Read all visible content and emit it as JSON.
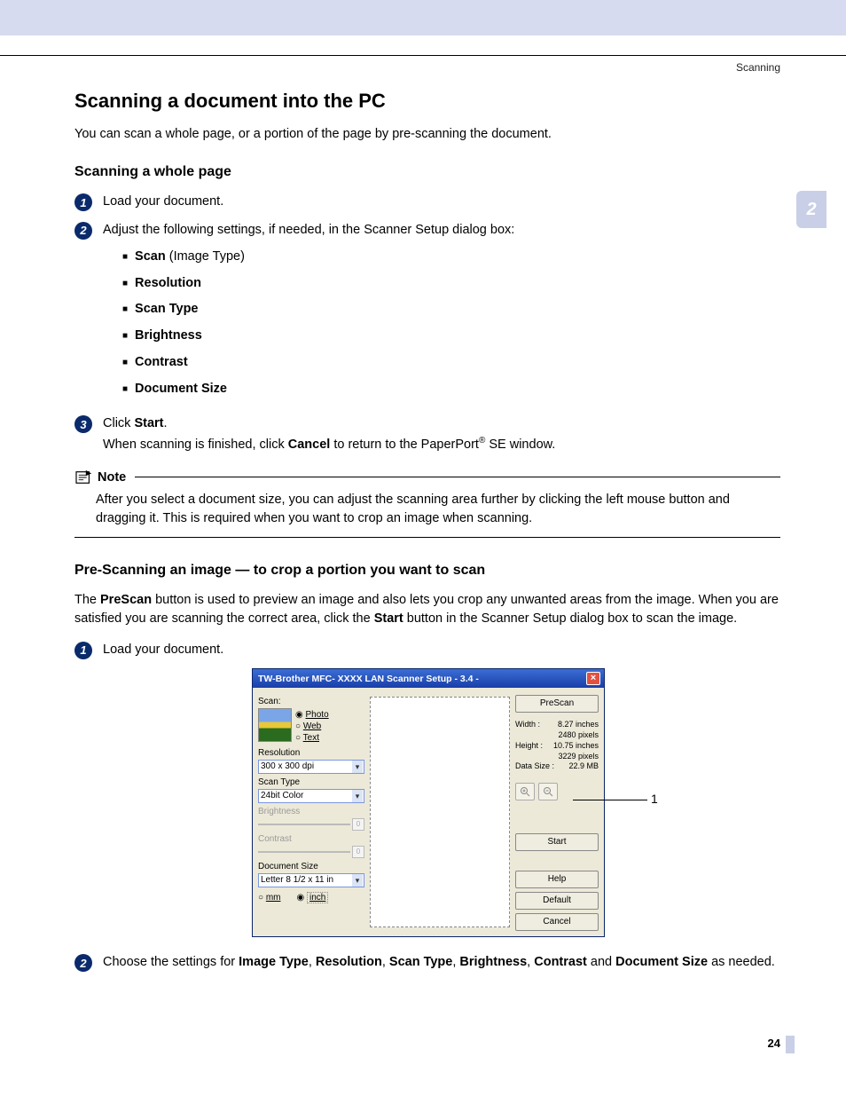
{
  "header": {
    "section": "Scanning",
    "chapter_tab": "2"
  },
  "h1": "Scanning a document into the PC",
  "intro": "You can scan a whole page, or a portion of the page by pre-scanning the document.",
  "secA": {
    "title": "Scanning a whole page",
    "step1": "Load your document.",
    "step2_lead": "Adjust the following settings, if needed, in the Scanner Setup dialog box:",
    "bullets_scan_prefix": "Scan",
    "bullets_scan_suffix": " (Image Type)",
    "b_resolution": "Resolution",
    "b_scantype": "Scan Type",
    "b_brightness": "Brightness",
    "b_contrast": "Contrast",
    "b_docsize": "Document Size",
    "step3_a": "Click ",
    "step3_b": "Start",
    "step3_c": ".",
    "step3_line2_a": "When scanning is finished, click ",
    "step3_line2_b": "Cancel",
    "step3_line2_c": " to return to the PaperPort",
    "step3_line2_d": " SE window."
  },
  "note": {
    "title": "Note",
    "body": "After you select a document size, you can adjust the scanning area further by clicking the left mouse button and dragging it. This is required when you want to crop an image when scanning."
  },
  "secB": {
    "title": "Pre-Scanning an image — to crop a portion you want to scan",
    "p_a": "The ",
    "p_b": "PreScan",
    "p_c": " button is used to preview an image and also lets you crop any unwanted areas from the image. When you are satisfied you are scanning the correct area, click the ",
    "p_d": "Start",
    "p_e": " button in the Scanner Setup dialog box to scan the image.",
    "step1": "Load your document.",
    "step2_a": "Choose the settings for ",
    "step2_b": "Image Type",
    "step2_c": ", ",
    "step2_d": "Resolution",
    "step2_e": ", ",
    "step2_f": "Scan Type",
    "step2_g": ", ",
    "step2_h": "Brightness",
    "step2_i": ", ",
    "step2_j": "Contrast",
    "step2_k": " and ",
    "step2_l": "Document Size",
    "step2_m": " as needed."
  },
  "dialog": {
    "title": "TW-Brother MFC- XXXX  LAN Scanner Setup - 3.4 -",
    "scan_label": "Scan:",
    "radio_photo": "Photo",
    "radio_web": "Web",
    "radio_text": "Text",
    "res_label": "Resolution",
    "res_value": "300 x 300 dpi",
    "scantype_label": "Scan Type",
    "scantype_value": "24bit Color",
    "brightness_label": "Brightness",
    "contrast_label": "Contrast",
    "docsize_label": "Document Size",
    "docsize_value": "Letter 8 1/2 x 11 in",
    "unit_mm": "mm",
    "unit_inch": "inch",
    "btn_prescan": "PreScan",
    "info_width_l": "Width :",
    "info_width_v": "8.27 inches",
    "info_width_px": "2480 pixels",
    "info_height_l": "Height :",
    "info_height_v": "10.75 inches",
    "info_height_px": "3229 pixels",
    "info_size_l": "Data Size :",
    "info_size_v": "22.9 MB",
    "btn_start": "Start",
    "btn_help": "Help",
    "btn_default": "Default",
    "btn_cancel": "Cancel"
  },
  "callout": "1",
  "page_number": "24"
}
